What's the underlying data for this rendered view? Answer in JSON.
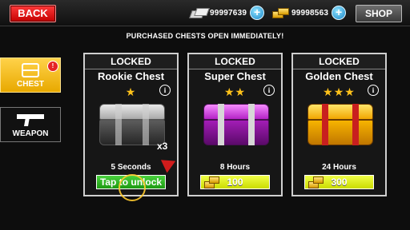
{
  "topbar": {
    "back_label": "BACK",
    "cash_amount": "99997639",
    "gold_amount": "99998563",
    "shop_label": "SHOP"
  },
  "banner": "PURCHASED CHESTS OPEN IMMEDIATELY!",
  "sidebar": {
    "tabs": [
      {
        "label": "CHEST",
        "badge": "!",
        "active": true
      },
      {
        "label": "WEAPON",
        "active": false
      }
    ]
  },
  "chests": [
    {
      "status": "LOCKED",
      "name": "Rookie Chest",
      "stars": "★",
      "timer": "5 Seconds",
      "action_label": "Tap to unlock"
    },
    {
      "status": "LOCKED",
      "name": "Super Chest",
      "stars": "★★",
      "timer": "8 Hours",
      "action_label": "100"
    },
    {
      "status": "LOCKED",
      "name": "Golden Chest",
      "stars": "★★★",
      "timer": "24 Hours",
      "action_label": "300"
    }
  ],
  "multiplier": "x3",
  "colors": {
    "accent_red": "#e02424",
    "tab_gold": "#f2b600",
    "unlock_green": "#2fb322",
    "buy_yellow": "#dcec12"
  },
  "icons": {
    "cash": "cash-icon",
    "gold": "gold-bars-icon",
    "add": "plus-icon",
    "info": "info-icon",
    "chest": "chest-icon",
    "weapon": "gun-icon",
    "pointer": "arrow-pointer-icon"
  }
}
